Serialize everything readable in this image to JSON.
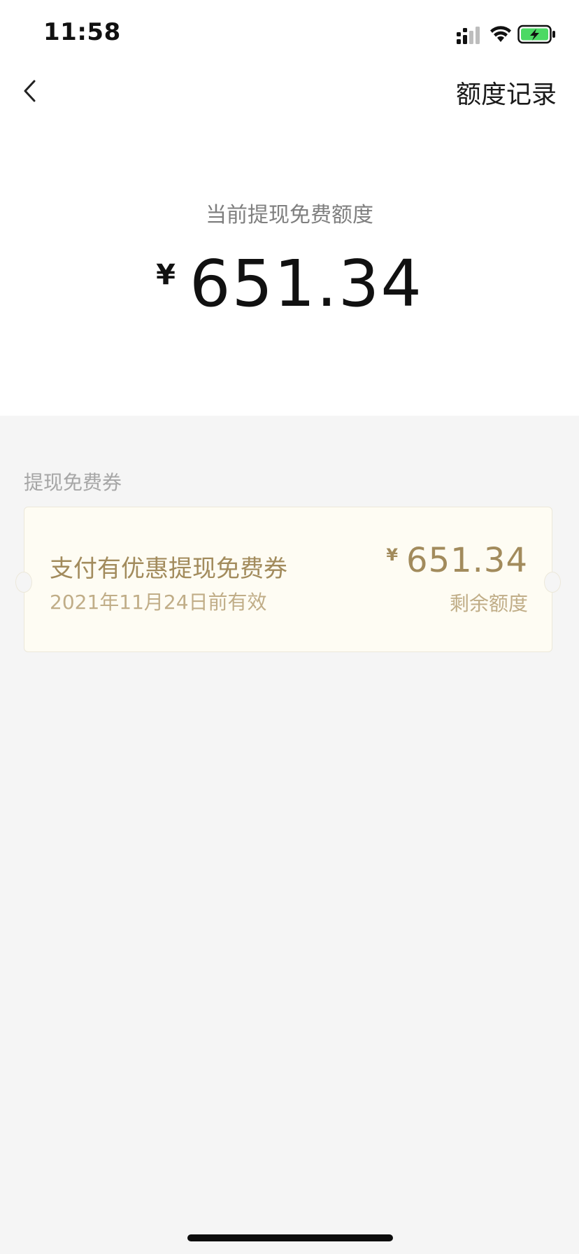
{
  "status_bar": {
    "time": "11:58",
    "icons": [
      "signal-icon",
      "wifi-icon",
      "battery-charging-icon"
    ]
  },
  "nav": {
    "back_icon": "chevron-left-icon",
    "records_label": "额度记录"
  },
  "summary": {
    "label": "当前提现免费额度",
    "currency": "¥",
    "amount": "651.34"
  },
  "section": {
    "title": "提现免费券"
  },
  "coupon": {
    "name": "支付有优惠提现免费券",
    "expiry": "2021年11月24日前有效",
    "currency": "¥",
    "amount": "651.34",
    "amount_label": "剩余额度"
  },
  "colors": {
    "gold_text": "#a28b5c",
    "gold_light": "#c0ad87",
    "card_bg": "#fefcf3",
    "page_bg": "#f5f5f5",
    "battery_green": "#4cd964"
  }
}
